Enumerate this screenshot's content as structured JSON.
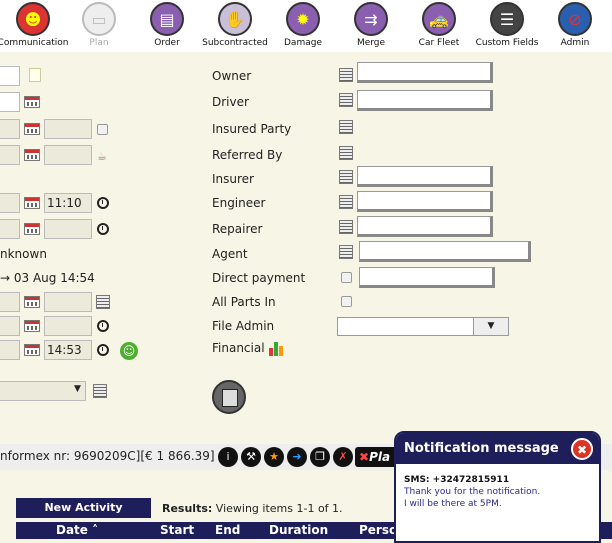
{
  "toolbar": {
    "items": [
      {
        "label": "Communication",
        "icon": "communication-icon"
      },
      {
        "label": "Plan",
        "icon": "plan-icon"
      },
      {
        "label": "Order",
        "icon": "order-icon"
      },
      {
        "label": "Subcontracted",
        "icon": "subcontracted-icon"
      },
      {
        "label": "Damage",
        "icon": "damage-icon"
      },
      {
        "label": "Merge",
        "icon": "merge-icon"
      },
      {
        "label": "Car Fleet",
        "icon": "car-fleet-icon"
      },
      {
        "label": "Custom Fields",
        "icon": "custom-fields-icon"
      },
      {
        "label": "Admin",
        "icon": "admin-icon"
      }
    ]
  },
  "left": {
    "time1": "11:10",
    "unknown_text": "nknown",
    "date_text": "→ 03 Aug 14:54",
    "time2": "14:53"
  },
  "fields": {
    "owner": "Owner",
    "driver": "Driver",
    "insured_party": "Insured Party",
    "referred_by": "Referred By",
    "insurer": "Insurer",
    "engineer": "Engineer",
    "repairer": "Repairer",
    "agent": "Agent",
    "direct_payment": "Direct payment",
    "all_parts_in": "All Parts In",
    "file_admin": "File Admin",
    "financial": "Financial"
  },
  "statusbar": {
    "text": "nformex nr: 9690209C][€ 1 866.39]",
    "play_label": "Pla"
  },
  "activity": {
    "new_button": "New Activity",
    "results_label": "Results:",
    "results_text": "Viewing items 1-1 of 1.",
    "columns": [
      "Date ˄",
      "Start",
      "End",
      "Duration",
      "Perso"
    ]
  },
  "notification": {
    "title": "Notification message",
    "sms": "SMS: +32472815911",
    "line1": "Thank you for the notification.",
    "line2": "I will be there at 5PM."
  },
  "colors": {
    "accent": "#1e1e5a",
    "background": "#f7f5e6",
    "close": "#dd3322"
  }
}
